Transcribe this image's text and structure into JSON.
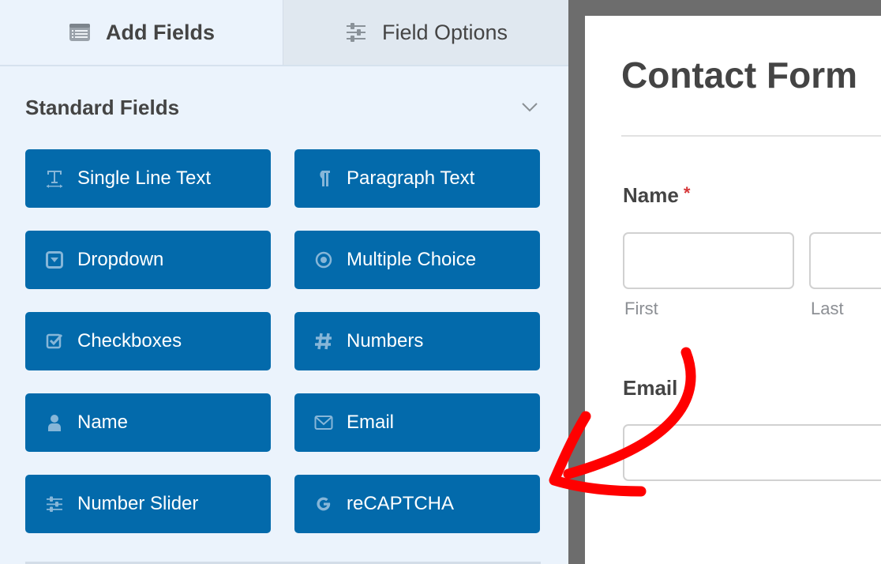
{
  "tabs": {
    "add_fields": {
      "label": "Add Fields",
      "icon": "list-icon",
      "active": true
    },
    "field_options": {
      "label": "Field Options",
      "icon": "sliders-icon",
      "active": false
    }
  },
  "section": {
    "title": "Standard Fields",
    "toggle_icon": "chevron-down-icon"
  },
  "fields": [
    {
      "label": "Single Line Text",
      "icon": "text-cursor-icon"
    },
    {
      "label": "Paragraph Text",
      "icon": "pilcrow-icon"
    },
    {
      "label": "Dropdown",
      "icon": "dropdown-icon"
    },
    {
      "label": "Multiple Choice",
      "icon": "radio-icon"
    },
    {
      "label": "Checkboxes",
      "icon": "checkbox-icon"
    },
    {
      "label": "Numbers",
      "icon": "hash-icon"
    },
    {
      "label": "Name",
      "icon": "user-icon"
    },
    {
      "label": "Email",
      "icon": "envelope-icon"
    },
    {
      "label": "Number Slider",
      "icon": "sliders-icon"
    },
    {
      "label": "reCAPTCHA",
      "icon": "google-g-icon"
    }
  ],
  "form": {
    "title": "Contact Form",
    "name_field": {
      "label": "Name",
      "required_mark": "*",
      "first_value": "",
      "last_value": "",
      "first_sublabel": "First",
      "last_sublabel": "Last"
    },
    "email_field": {
      "label": "Email",
      "value": ""
    }
  },
  "annotation": {
    "type": "arrow",
    "color": "#ff0000",
    "points_to": "reCAPTCHA"
  },
  "colors": {
    "button_bg": "#036aab",
    "panel_bg": "#ebf3fc",
    "inactive_tab_bg": "#e0e8f0",
    "required": "#d63638",
    "separator": "#6d6d6d"
  }
}
